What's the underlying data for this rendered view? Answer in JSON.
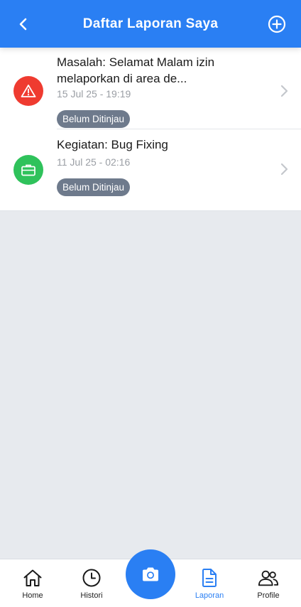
{
  "header": {
    "title": "Daftar Laporan Saya",
    "back_icon": "chevron-left-icon",
    "add_icon": "plus-circle-icon",
    "color": "#2a7ff3"
  },
  "reports": [
    {
      "title": "Masalah: Selamat Malam izin melaporkan di area de...",
      "date": "15 Jul 25 - 19:19",
      "status": "Belum Ditinjau",
      "icon": "warning-icon",
      "icon_color": "#ef3b30"
    },
    {
      "title": "Kegiatan: Bug Fixing",
      "date": "11 Jul 25 - 02:16",
      "status": "Belum Ditinjau",
      "icon": "briefcase-icon",
      "icon_color": "#2fc25b"
    }
  ],
  "nav": {
    "home": "Home",
    "histori": "Histori",
    "laporan": "Laporan",
    "profile": "Profile",
    "active": "laporan",
    "camera_icon": "camera-icon"
  }
}
